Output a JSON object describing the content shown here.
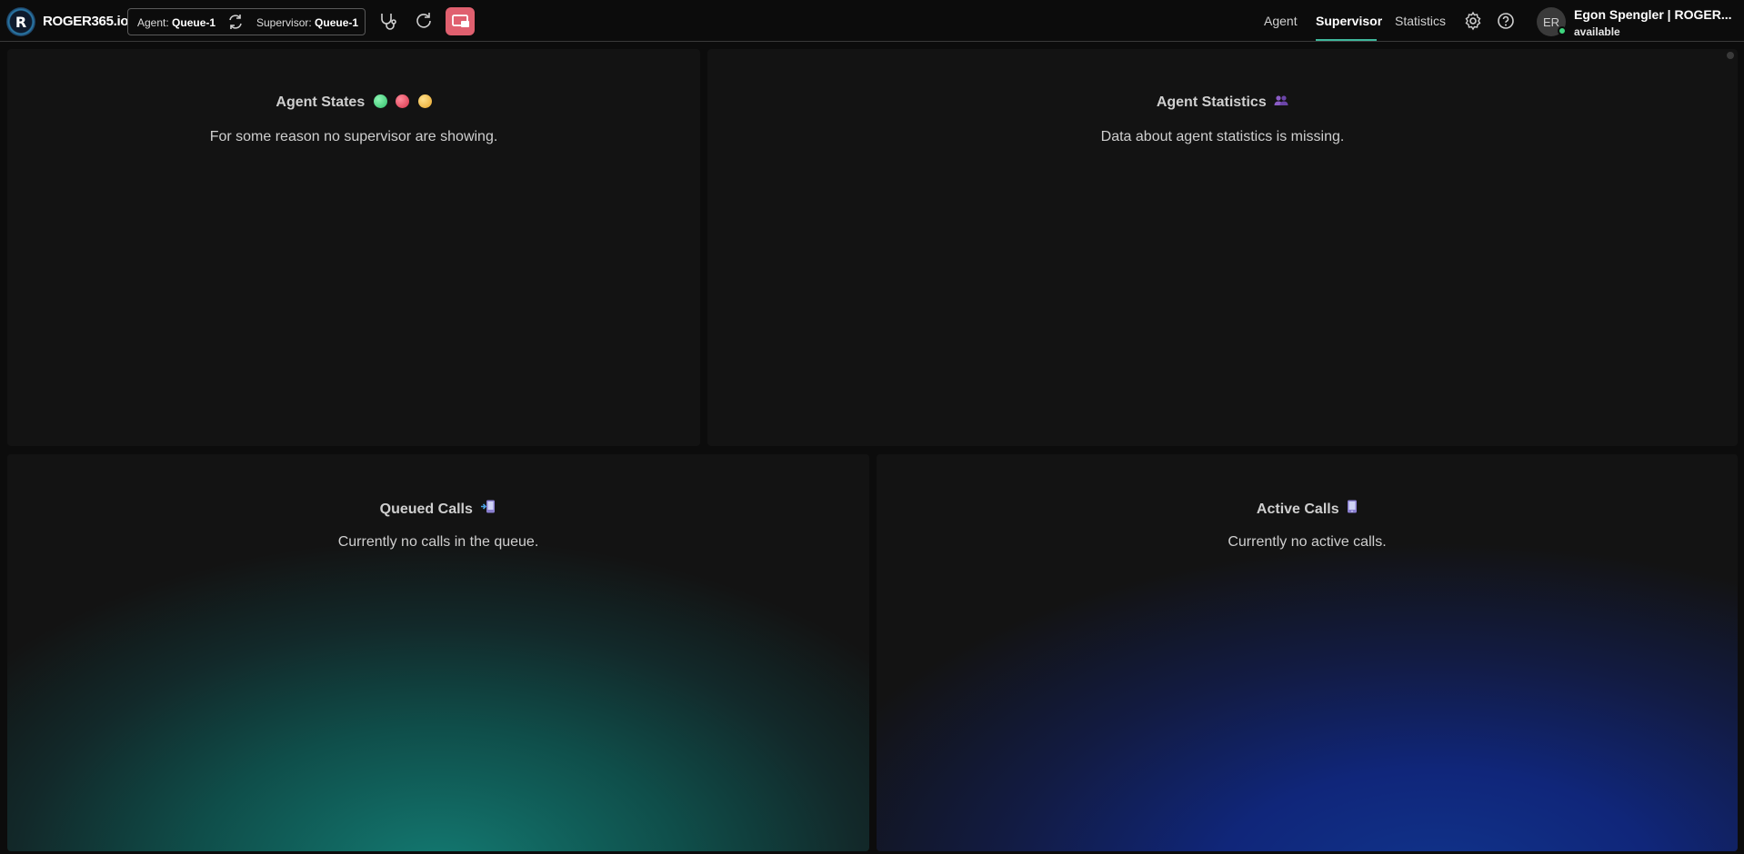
{
  "header": {
    "logo_letter": "R",
    "brand": "ROGER365.io",
    "agent_prefix": "Agent:",
    "agent_queue": "Queue-1",
    "supervisor_prefix": "Supervisor:",
    "supervisor_queue": "Queue-1",
    "nav": [
      "Agent",
      "Supervisor",
      "Statistics"
    ],
    "active_nav": "Supervisor",
    "user_initials": "ER",
    "user_name": "Egon Spengler | ROGER...",
    "user_status": "available",
    "colors": {
      "accent": "#3fb79b",
      "share_button": "#e0606f",
      "status_available": "#3ed67e"
    }
  },
  "panels": {
    "agent_states": {
      "title": "Agent States",
      "message": "For some reason no supervisor are showing.",
      "icons": [
        "green-circle",
        "red-circle",
        "yellow-circle"
      ]
    },
    "agent_statistics": {
      "title": "Agent Statistics",
      "message": "Data about agent statistics is missing.",
      "icon": "people-icon"
    },
    "queued_calls": {
      "title": "Queued Calls",
      "message": "Currently no calls in the queue.",
      "icon": "phone-incoming-icon"
    },
    "active_calls": {
      "title": "Active Calls",
      "message": "Currently no active calls.",
      "icon": "mobile-phone-icon"
    }
  }
}
